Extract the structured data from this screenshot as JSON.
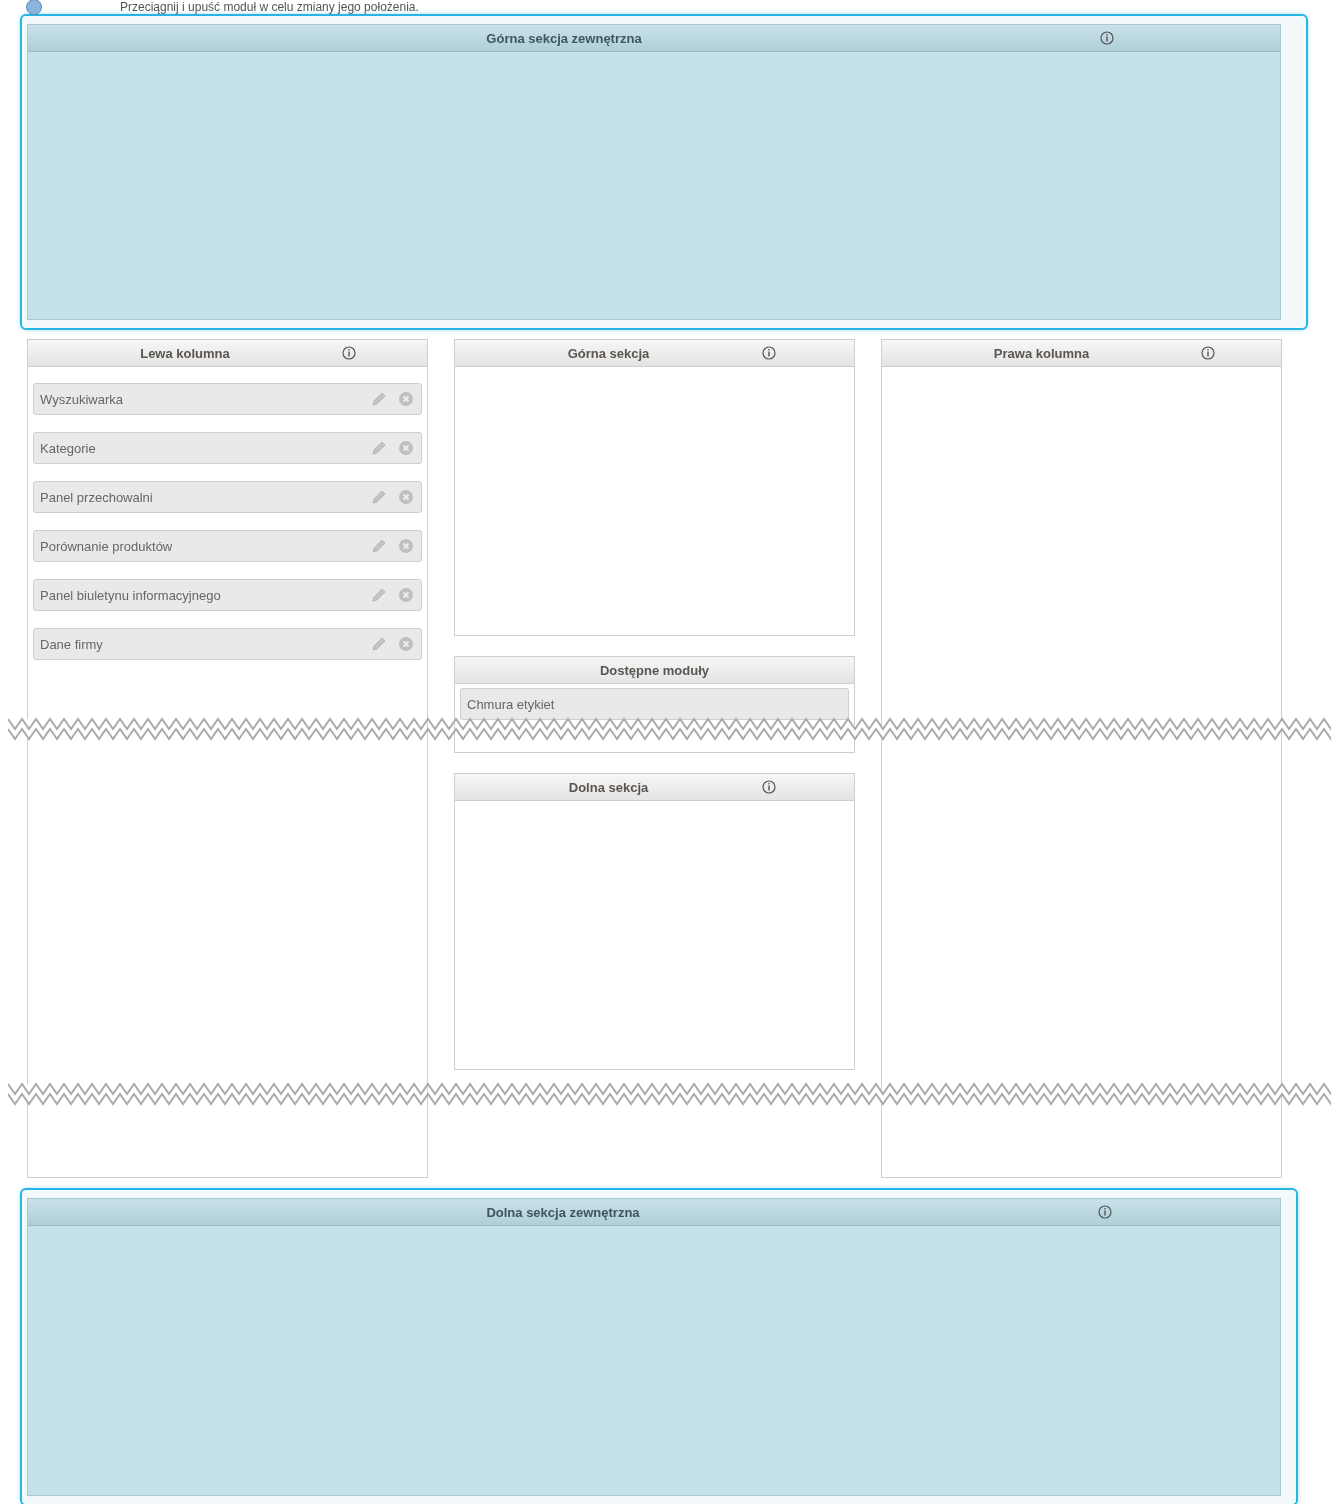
{
  "hint": {
    "text": "Przeciągnij i upuść moduł w celu zmiany jego położenia."
  },
  "top_outer": {
    "title": "Górna sekcja zewnętrzna",
    "info": true
  },
  "left_column": {
    "title": "Lewa kolumna",
    "info": true,
    "modules": [
      {
        "name": "Wyszukiwarka"
      },
      {
        "name": "Kategorie"
      },
      {
        "name": "Panel przechowalni"
      },
      {
        "name": "Porównanie produktów"
      },
      {
        "name": "Panel biuletynu informacyjnego"
      },
      {
        "name": "Dane firmy"
      }
    ]
  },
  "middle": [
    {
      "kind": "section",
      "title": "Górna sekcja",
      "info": true
    },
    {
      "kind": "available",
      "title": "Dostępne moduły",
      "info": false,
      "modules": [
        {
          "name": "Chmura etykiet"
        }
      ]
    },
    {
      "kind": "section",
      "title": "Dolna sekcja",
      "info": true
    }
  ],
  "right_column": {
    "title": "Prawa kolumna",
    "info": true
  },
  "bottom_outer": {
    "title": "Dolna sekcja zewnętrzna",
    "info": true
  }
}
